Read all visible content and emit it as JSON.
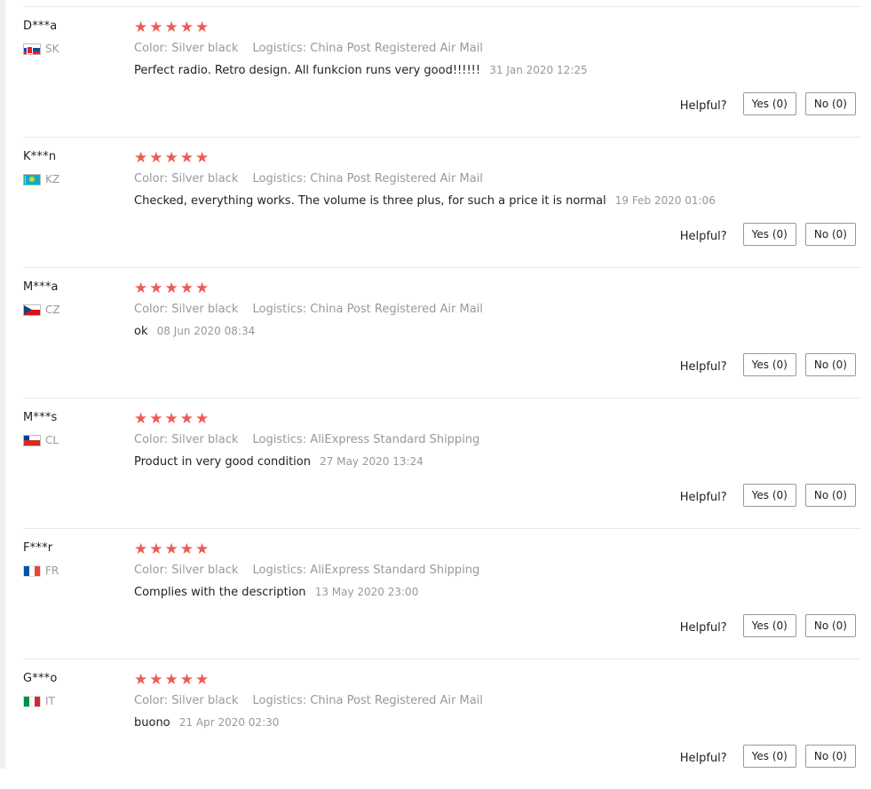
{
  "helpful_label": "Helpful?",
  "attr_labels": {
    "color": "Color:",
    "logistics": "Logistics:"
  },
  "rating_stars": "★★★★★",
  "reviews": [
    {
      "user": "D***a",
      "country": "SK",
      "rating": 5,
      "color": "Silver black",
      "logistics": "China Post Registered Air Mail",
      "text": "Perfect radio. Retro design. All funkcion runs very good!!!!!!",
      "date": "31 Jan 2020 12:25",
      "yes": "Yes (0)",
      "no": "No (0)"
    },
    {
      "user": "K***n",
      "country": "KZ",
      "rating": 5,
      "color": "Silver black",
      "logistics": "China Post Registered Air Mail",
      "text": "Checked, everything works. The volume is three plus, for such a price it is normal",
      "date": "19 Feb 2020 01:06",
      "yes": "Yes (0)",
      "no": "No (0)"
    },
    {
      "user": "M***a",
      "country": "CZ",
      "rating": 5,
      "color": "Silver black",
      "logistics": "China Post Registered Air Mail",
      "text": "ok",
      "date": "08 Jun 2020 08:34",
      "yes": "Yes (0)",
      "no": "No (0)"
    },
    {
      "user": "M***s",
      "country": "CL",
      "rating": 5,
      "color": "Silver black",
      "logistics": "AliExpress Standard Shipping",
      "text": "Product in very good condition",
      "date": "27 May 2020 13:24",
      "yes": "Yes (0)",
      "no": "No (0)"
    },
    {
      "user": "F***r",
      "country": "FR",
      "rating": 5,
      "color": "Silver black",
      "logistics": "AliExpress Standard Shipping",
      "text": "Complies with the description",
      "date": "13 May 2020 23:00",
      "yes": "Yes (0)",
      "no": "No (0)"
    },
    {
      "user": "G***o",
      "country": "IT",
      "rating": 5,
      "color": "Silver black",
      "logistics": "China Post Registered Air Mail",
      "text": "buono",
      "date": "21 Apr 2020 02:30",
      "yes": "Yes (0)",
      "no": "No (0)"
    }
  ],
  "colors": {
    "star": "#ec5c54",
    "muted": "#999999",
    "text": "#222222",
    "divider": "#e8e8e8"
  }
}
